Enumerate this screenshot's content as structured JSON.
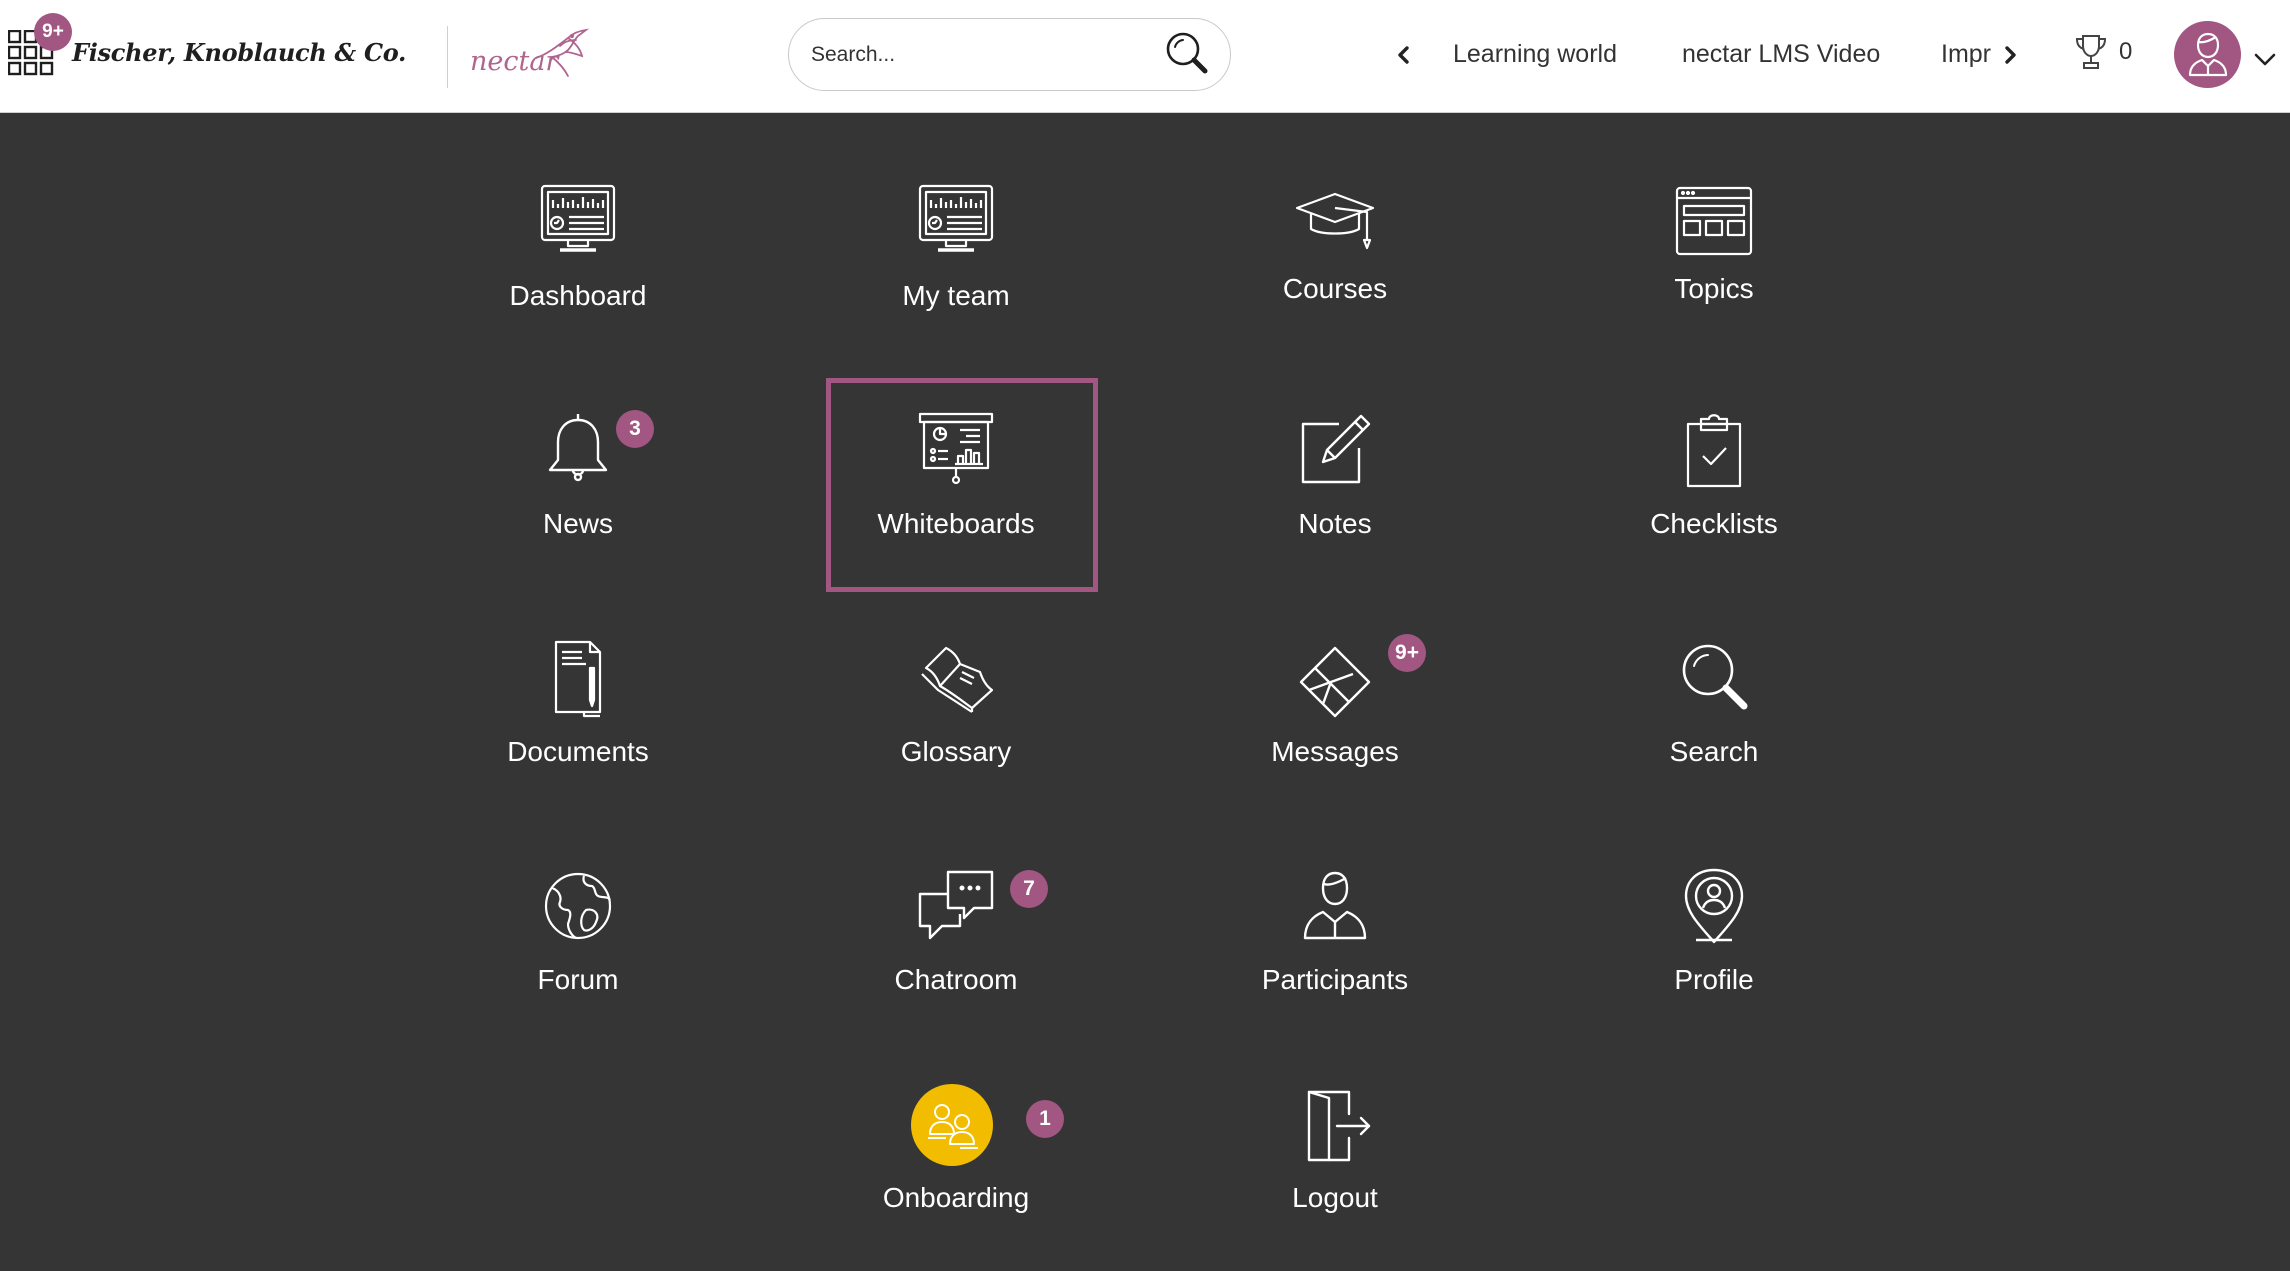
{
  "header": {
    "apps_badge": "9+",
    "company_name": "Fischer, Knoblauch & Co.",
    "brand_logo": "nectar",
    "search": {
      "placeholder": "Search..."
    },
    "nav_links": [
      "Learning world",
      "nectar LMS Video",
      "Impr"
    ],
    "trophy_count": "0"
  },
  "tiles": [
    {
      "label": "Dashboard",
      "icon": "dashboard-monitor-icon"
    },
    {
      "label": "My team",
      "icon": "team-monitor-icon"
    },
    {
      "label": "Courses",
      "icon": "graduation-cap-icon"
    },
    {
      "label": "Topics",
      "icon": "topics-window-icon"
    },
    {
      "label": "News",
      "icon": "bell-icon",
      "badge": "3"
    },
    {
      "label": "Whiteboards",
      "icon": "whiteboard-icon",
      "selected": true
    },
    {
      "label": "Notes",
      "icon": "note-pencil-icon"
    },
    {
      "label": "Checklists",
      "icon": "clipboard-check-icon"
    },
    {
      "label": "Documents",
      "icon": "document-icon"
    },
    {
      "label": "Glossary",
      "icon": "book-icon"
    },
    {
      "label": "Messages",
      "icon": "envelope-icon",
      "badge": "9+"
    },
    {
      "label": "Search",
      "icon": "search-icon"
    },
    {
      "label": "Forum",
      "icon": "globe-icon"
    },
    {
      "label": "Chatroom",
      "icon": "chat-bubbles-icon",
      "badge": "7"
    },
    {
      "label": "Participants",
      "icon": "person-icon"
    },
    {
      "label": "Profile",
      "icon": "location-pin-user-icon"
    },
    {
      "label": "Onboarding",
      "icon": "onboarding-people-icon",
      "badge": "1"
    },
    {
      "label": "Logout",
      "icon": "logout-door-icon"
    }
  ],
  "colors": {
    "accent": "#a25682",
    "background": "#353535",
    "header_background": "#ffffff",
    "onboarding_highlight": "#f2bd00",
    "tile_text": "#ffffff"
  }
}
